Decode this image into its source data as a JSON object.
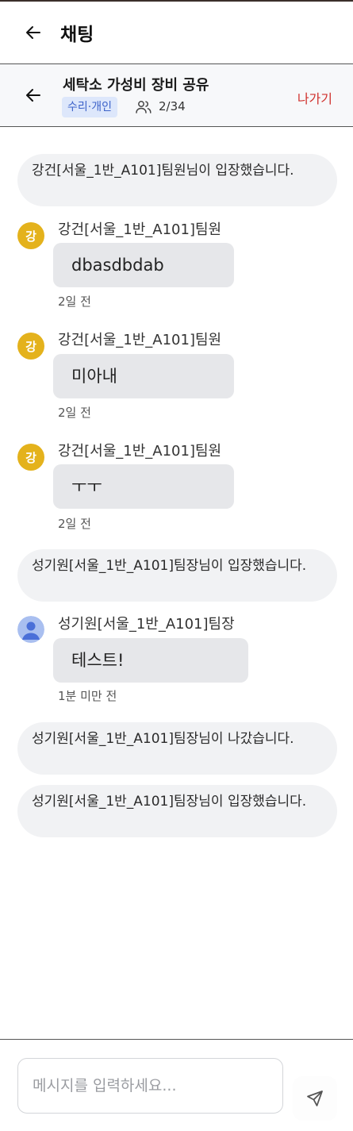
{
  "header": {
    "title": "채팅"
  },
  "room": {
    "title": "세탁소 가성비 장비 공유",
    "tag": "수리·개인",
    "members": "2/34",
    "leave_label": "나가기"
  },
  "messages": [
    {
      "type": "notice",
      "text": "강건[서울_1반_A101]팀원님이 입장했습니다."
    },
    {
      "type": "chat",
      "avatar": "강",
      "sender": "강건[서울_1반_A101]팀원",
      "text": "dbasdbdab",
      "time": "2일 전"
    },
    {
      "type": "chat",
      "avatar": "강",
      "sender": "강건[서울_1반_A101]팀원",
      "text": "미아내",
      "time": "2일 전"
    },
    {
      "type": "chat",
      "avatar": "강",
      "sender": "강건[서울_1반_A101]팀원",
      "text": "ㅜㅜ",
      "time": "2일 전"
    },
    {
      "type": "notice",
      "text": "성기원[서울_1반_A101]팀장님이 입장했습니다."
    },
    {
      "type": "chat",
      "avatar_icon": "user-avatar-icon",
      "sender": "성기원[서울_1반_A101]팀장",
      "text": "테스트!",
      "time": "1분 미만 전"
    },
    {
      "type": "notice",
      "text": "성기원[서울_1반_A101]팀장님이 나갔습니다."
    },
    {
      "type": "notice",
      "text": "성기원[서울_1반_A101]팀장님이 입장했습니다."
    }
  ],
  "composer": {
    "placeholder": "메시지를 입력하세요..."
  },
  "colors": {
    "accent_tag_bg": "#dde7fb",
    "accent_tag_text": "#3d63c9",
    "leave": "#d0312d",
    "avatar_letter_bg": "#e4b21c",
    "bubble_bg": "#e6e7ea"
  }
}
